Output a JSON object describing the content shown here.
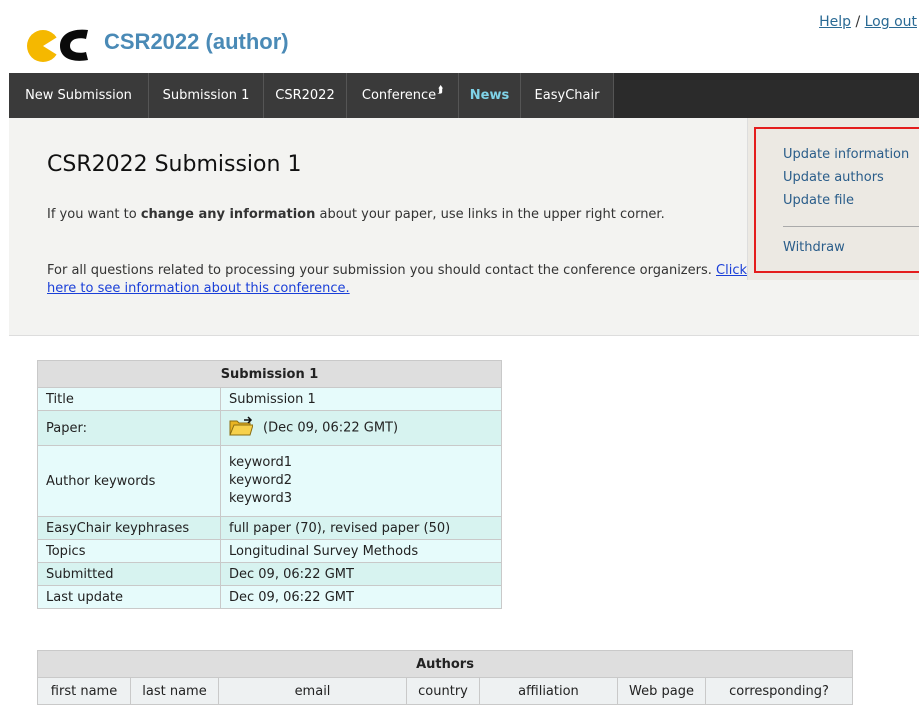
{
  "header": {
    "title": "CSR2022 (author)",
    "help_label": "Help",
    "separator": "/",
    "logout_label": "Log out"
  },
  "nav": {
    "items": [
      {
        "label": "New Submission"
      },
      {
        "label": "Submission 1"
      },
      {
        "label": "CSR2022"
      },
      {
        "label": "Conference",
        "icon": "return-arrow-icon"
      },
      {
        "label": "News"
      },
      {
        "label": "EasyChair"
      }
    ]
  },
  "main": {
    "title": "CSR2022 Submission 1",
    "para1_before": "If you want to ",
    "para1_bold": "change any information",
    "para1_after": " about your paper, use links in the upper right corner.",
    "para2_text": "For all questions related to processing your submission you should contact the conference organizers. ",
    "para2_link": "Click here to see information about this conference."
  },
  "side": {
    "update_information": "Update information",
    "update_authors": "Update authors",
    "update_file": "Update file",
    "withdraw": "Withdraw"
  },
  "submission_table": {
    "caption": "Submission 1",
    "title_label": "Title",
    "title_value": "Submission 1",
    "paper_label": "Paper:",
    "paper_value": "(Dec 09, 06:22 GMT)",
    "keywords_label": "Author keywords",
    "keywords": [
      "keyword1",
      "keyword2",
      "keyword3"
    ],
    "keyphrases_label": "EasyChair keyphrases",
    "keyphrases_value": "full paper (70), revised paper (50)",
    "topics_label": "Topics",
    "topics_value": "Longitudinal Survey Methods",
    "submitted_label": "Submitted",
    "submitted_value": "Dec 09, 06:22 GMT",
    "last_update_label": "Last update",
    "last_update_value": "Dec 09, 06:22 GMT"
  },
  "authors_table": {
    "caption": "Authors",
    "columns": [
      "first name",
      "last name",
      "email",
      "country",
      "affiliation",
      "Web page",
      "corresponding?"
    ]
  },
  "colors": {
    "title_blue": "#4a8ab6",
    "nav_bg": "#2b2b2b",
    "highlight_red": "#e41d1d",
    "news_accent": "#7fd3e8"
  }
}
